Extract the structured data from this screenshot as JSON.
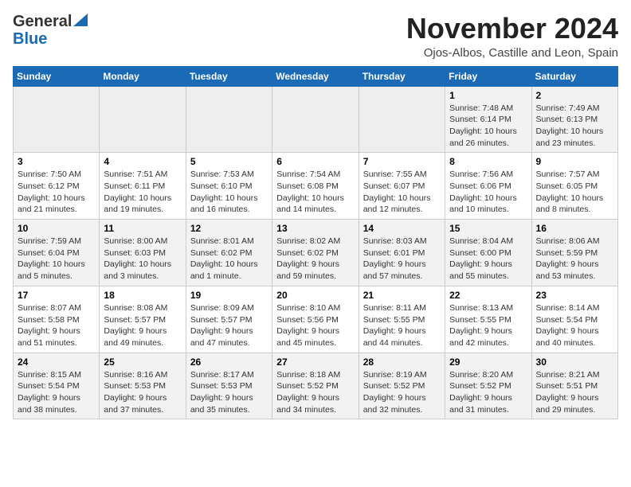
{
  "header": {
    "logo_general": "General",
    "logo_blue": "Blue",
    "month_title": "November 2024",
    "location": "Ojos-Albos, Castille and Leon, Spain"
  },
  "weekdays": [
    "Sunday",
    "Monday",
    "Tuesday",
    "Wednesday",
    "Thursday",
    "Friday",
    "Saturday"
  ],
  "weeks": [
    [
      {
        "day": "",
        "info": ""
      },
      {
        "day": "",
        "info": ""
      },
      {
        "day": "",
        "info": ""
      },
      {
        "day": "",
        "info": ""
      },
      {
        "day": "",
        "info": ""
      },
      {
        "day": "1",
        "info": "Sunrise: 7:48 AM\nSunset: 6:14 PM\nDaylight: 10 hours and 26 minutes."
      },
      {
        "day": "2",
        "info": "Sunrise: 7:49 AM\nSunset: 6:13 PM\nDaylight: 10 hours and 23 minutes."
      }
    ],
    [
      {
        "day": "3",
        "info": "Sunrise: 7:50 AM\nSunset: 6:12 PM\nDaylight: 10 hours and 21 minutes."
      },
      {
        "day": "4",
        "info": "Sunrise: 7:51 AM\nSunset: 6:11 PM\nDaylight: 10 hours and 19 minutes."
      },
      {
        "day": "5",
        "info": "Sunrise: 7:53 AM\nSunset: 6:10 PM\nDaylight: 10 hours and 16 minutes."
      },
      {
        "day": "6",
        "info": "Sunrise: 7:54 AM\nSunset: 6:08 PM\nDaylight: 10 hours and 14 minutes."
      },
      {
        "day": "7",
        "info": "Sunrise: 7:55 AM\nSunset: 6:07 PM\nDaylight: 10 hours and 12 minutes."
      },
      {
        "day": "8",
        "info": "Sunrise: 7:56 AM\nSunset: 6:06 PM\nDaylight: 10 hours and 10 minutes."
      },
      {
        "day": "9",
        "info": "Sunrise: 7:57 AM\nSunset: 6:05 PM\nDaylight: 10 hours and 8 minutes."
      }
    ],
    [
      {
        "day": "10",
        "info": "Sunrise: 7:59 AM\nSunset: 6:04 PM\nDaylight: 10 hours and 5 minutes."
      },
      {
        "day": "11",
        "info": "Sunrise: 8:00 AM\nSunset: 6:03 PM\nDaylight: 10 hours and 3 minutes."
      },
      {
        "day": "12",
        "info": "Sunrise: 8:01 AM\nSunset: 6:02 PM\nDaylight: 10 hours and 1 minute."
      },
      {
        "day": "13",
        "info": "Sunrise: 8:02 AM\nSunset: 6:02 PM\nDaylight: 9 hours and 59 minutes."
      },
      {
        "day": "14",
        "info": "Sunrise: 8:03 AM\nSunset: 6:01 PM\nDaylight: 9 hours and 57 minutes."
      },
      {
        "day": "15",
        "info": "Sunrise: 8:04 AM\nSunset: 6:00 PM\nDaylight: 9 hours and 55 minutes."
      },
      {
        "day": "16",
        "info": "Sunrise: 8:06 AM\nSunset: 5:59 PM\nDaylight: 9 hours and 53 minutes."
      }
    ],
    [
      {
        "day": "17",
        "info": "Sunrise: 8:07 AM\nSunset: 5:58 PM\nDaylight: 9 hours and 51 minutes."
      },
      {
        "day": "18",
        "info": "Sunrise: 8:08 AM\nSunset: 5:57 PM\nDaylight: 9 hours and 49 minutes."
      },
      {
        "day": "19",
        "info": "Sunrise: 8:09 AM\nSunset: 5:57 PM\nDaylight: 9 hours and 47 minutes."
      },
      {
        "day": "20",
        "info": "Sunrise: 8:10 AM\nSunset: 5:56 PM\nDaylight: 9 hours and 45 minutes."
      },
      {
        "day": "21",
        "info": "Sunrise: 8:11 AM\nSunset: 5:55 PM\nDaylight: 9 hours and 44 minutes."
      },
      {
        "day": "22",
        "info": "Sunrise: 8:13 AM\nSunset: 5:55 PM\nDaylight: 9 hours and 42 minutes."
      },
      {
        "day": "23",
        "info": "Sunrise: 8:14 AM\nSunset: 5:54 PM\nDaylight: 9 hours and 40 minutes."
      }
    ],
    [
      {
        "day": "24",
        "info": "Sunrise: 8:15 AM\nSunset: 5:54 PM\nDaylight: 9 hours and 38 minutes."
      },
      {
        "day": "25",
        "info": "Sunrise: 8:16 AM\nSunset: 5:53 PM\nDaylight: 9 hours and 37 minutes."
      },
      {
        "day": "26",
        "info": "Sunrise: 8:17 AM\nSunset: 5:53 PM\nDaylight: 9 hours and 35 minutes."
      },
      {
        "day": "27",
        "info": "Sunrise: 8:18 AM\nSunset: 5:52 PM\nDaylight: 9 hours and 34 minutes."
      },
      {
        "day": "28",
        "info": "Sunrise: 8:19 AM\nSunset: 5:52 PM\nDaylight: 9 hours and 32 minutes."
      },
      {
        "day": "29",
        "info": "Sunrise: 8:20 AM\nSunset: 5:52 PM\nDaylight: 9 hours and 31 minutes."
      },
      {
        "day": "30",
        "info": "Sunrise: 8:21 AM\nSunset: 5:51 PM\nDaylight: 9 hours and 29 minutes."
      }
    ]
  ]
}
